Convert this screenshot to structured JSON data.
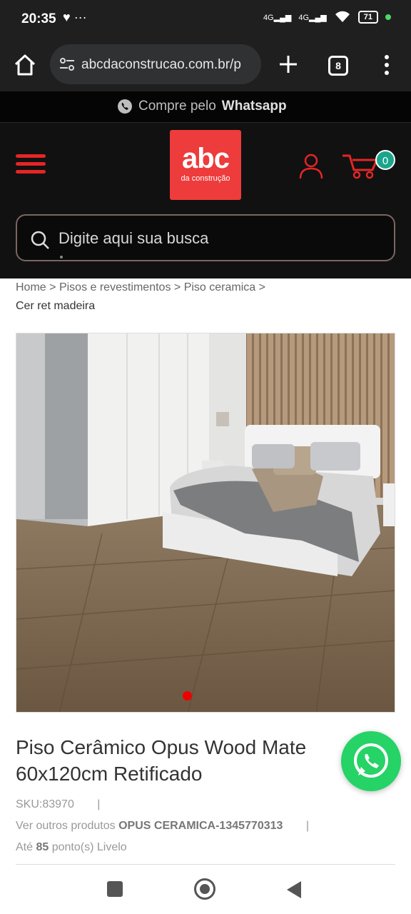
{
  "status_bar": {
    "time": "20:35",
    "left_icons": "♥ ···",
    "signal1": "4G",
    "signal2": "4G",
    "battery": "71"
  },
  "browser": {
    "url": "abcdaconstrucao.com.br/p",
    "tab_count": "8"
  },
  "whatsapp_bar": {
    "text": "Compre pelo",
    "strong": "Whatsapp"
  },
  "header": {
    "logo_main": "abc",
    "logo_sub": "da construção",
    "cart_count": "0",
    "search_placeholder": "Digite aqui sua busca"
  },
  "breadcrumb": {
    "items": [
      "Home",
      "Pisos e revestimentos",
      "Piso ceramica"
    ],
    "separator": ">",
    "current": "Cer ret madeira"
  },
  "product": {
    "title_line1": "Piso Cerâmico Opus Wood Mate",
    "title_line2": "60x120cm Retificado",
    "sku": "SKU:83970",
    "other_products_label": "Ver outros produtos",
    "other_products_brand": "OPUS CERAMICA-1345770313",
    "points_prefix": "Até",
    "points_value": "85",
    "points_suffix": "ponto(s) Livelo",
    "separator": "|"
  },
  "colors": {
    "brand_red": "#ee3b3b",
    "whatsapp_green": "#25d366",
    "badge_teal": "#1aa58c"
  }
}
